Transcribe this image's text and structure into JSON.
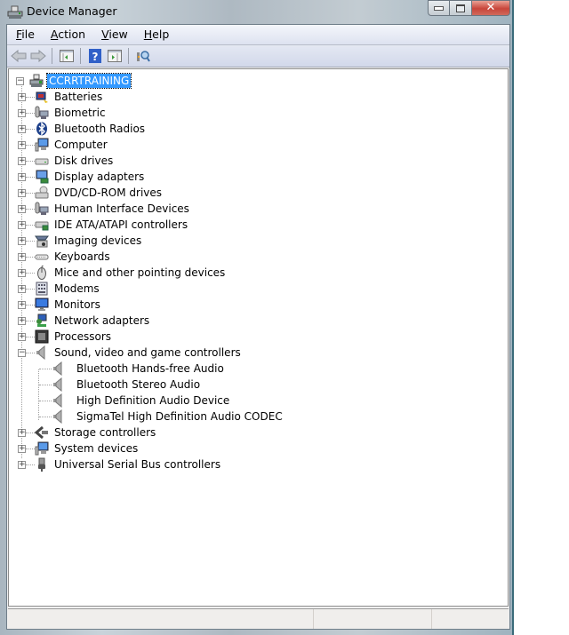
{
  "window": {
    "title": "Device Manager",
    "icon": "device-manager-icon",
    "caption_buttons": [
      "minimize",
      "maximize",
      "close"
    ]
  },
  "menu": [
    {
      "label": "File",
      "underline": "F",
      "rest": "ile"
    },
    {
      "label": "Action",
      "underline": "A",
      "rest": "ction"
    },
    {
      "label": "View",
      "underline": "V",
      "rest": "iew"
    },
    {
      "label": "Help",
      "underline": "H",
      "rest": "elp"
    }
  ],
  "toolbar": [
    {
      "name": "back",
      "icon": "back-arrow-icon"
    },
    {
      "name": "forward",
      "icon": "forward-arrow-icon"
    },
    {
      "name": "show-hide-console-tree",
      "icon": "console-tree-icon"
    },
    {
      "name": "help",
      "icon": "help-icon"
    },
    {
      "name": "show-hide-action-pane",
      "icon": "action-pane-icon"
    },
    {
      "name": "scan-hardware-changes",
      "icon": "scan-hardware-icon"
    }
  ],
  "tree": {
    "root": {
      "label": "CCRRTRAINING",
      "icon": "computer-root-icon",
      "expanded": true,
      "selected": true
    },
    "categories": [
      {
        "label": "Batteries",
        "icon": "battery-icon",
        "expanded": false
      },
      {
        "label": "Biometric",
        "icon": "biometric-icon",
        "expanded": false
      },
      {
        "label": "Bluetooth Radios",
        "icon": "bluetooth-icon",
        "expanded": false
      },
      {
        "label": "Computer",
        "icon": "computer-icon",
        "expanded": false
      },
      {
        "label": "Disk drives",
        "icon": "disk-drive-icon",
        "expanded": false
      },
      {
        "label": "Display adapters",
        "icon": "display-adapter-icon",
        "expanded": false
      },
      {
        "label": "DVD/CD-ROM drives",
        "icon": "dvd-drive-icon",
        "expanded": false
      },
      {
        "label": "Human Interface Devices",
        "icon": "hid-icon",
        "expanded": false
      },
      {
        "label": "IDE ATA/ATAPI controllers",
        "icon": "ide-controller-icon",
        "expanded": false
      },
      {
        "label": "Imaging devices",
        "icon": "imaging-device-icon",
        "expanded": false
      },
      {
        "label": "Keyboards",
        "icon": "keyboard-icon",
        "expanded": false
      },
      {
        "label": "Mice and other pointing devices",
        "icon": "mouse-icon",
        "expanded": false
      },
      {
        "label": "Modems",
        "icon": "modem-icon",
        "expanded": false
      },
      {
        "label": "Monitors",
        "icon": "monitor-icon",
        "expanded": false
      },
      {
        "label": "Network adapters",
        "icon": "network-adapter-icon",
        "expanded": false
      },
      {
        "label": "Processors",
        "icon": "processor-icon",
        "expanded": false
      },
      {
        "label": "Sound, video and game controllers",
        "icon": "speaker-icon",
        "expanded": true,
        "children": [
          {
            "label": "Bluetooth Hands-free Audio",
            "icon": "speaker-icon"
          },
          {
            "label": "Bluetooth Stereo Audio",
            "icon": "speaker-icon"
          },
          {
            "label": "High Definition Audio Device",
            "icon": "speaker-icon"
          },
          {
            "label": "SigmaTel High Definition Audio CODEC",
            "icon": "speaker-icon"
          }
        ]
      },
      {
        "label": "Storage controllers",
        "icon": "storage-controller-icon",
        "expanded": false
      },
      {
        "label": "System devices",
        "icon": "system-device-icon",
        "expanded": false
      },
      {
        "label": "Universal Serial Bus controllers",
        "icon": "usb-icon",
        "expanded": false
      }
    ]
  },
  "statusbar": {
    "panes": [
      "",
      "",
      ""
    ]
  }
}
